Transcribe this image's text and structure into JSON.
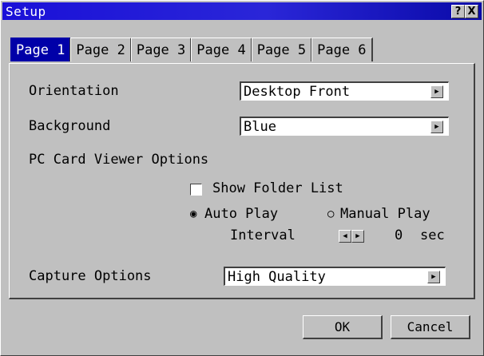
{
  "window": {
    "title": "Setup",
    "help_label": "?",
    "close_label": "X"
  },
  "tabs": [
    {
      "label": "Page 1",
      "active": true
    },
    {
      "label": "Page 2",
      "active": false
    },
    {
      "label": "Page 3",
      "active": false
    },
    {
      "label": "Page 4",
      "active": false
    },
    {
      "label": "Page 5",
      "active": false
    },
    {
      "label": "Page 6",
      "active": false
    }
  ],
  "orientation": {
    "label": "Orientation",
    "value": "Desktop Front"
  },
  "background": {
    "label": "Background",
    "value": "Blue"
  },
  "pc_card": {
    "section_label": "PC Card Viewer Options",
    "show_folder_list": {
      "label": "Show Folder List",
      "checked": false
    },
    "auto_play": {
      "label": "Auto Play",
      "selected": true
    },
    "manual_play": {
      "label": "Manual Play",
      "selected": false
    },
    "interval": {
      "label": "Interval",
      "value": "0",
      "unit": "sec"
    }
  },
  "capture": {
    "label": "Capture Options",
    "value": "High Quality"
  },
  "buttons": {
    "ok": "OK",
    "cancel": "Cancel"
  },
  "colors": {
    "titlebar": "#1a10d8",
    "active_tab": "#0000a8",
    "face": "#c0c0c0"
  }
}
